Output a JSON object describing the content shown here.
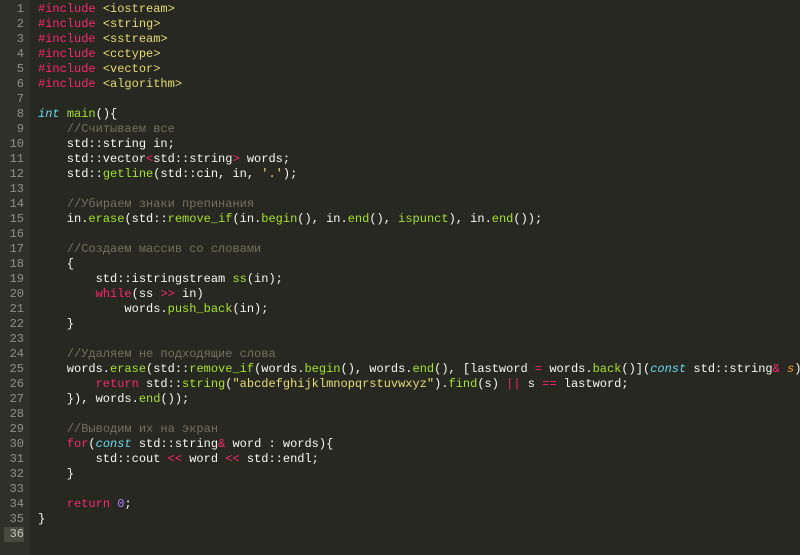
{
  "file_language": "cpp",
  "lines": [
    [
      {
        "t": "#include",
        "c": "include"
      },
      {
        "t": " ",
        "c": "punc"
      },
      {
        "t": "<iostream>",
        "c": "header"
      }
    ],
    [
      {
        "t": "#include",
        "c": "include"
      },
      {
        "t": " ",
        "c": "punc"
      },
      {
        "t": "<string>",
        "c": "header"
      }
    ],
    [
      {
        "t": "#include",
        "c": "include"
      },
      {
        "t": " ",
        "c": "punc"
      },
      {
        "t": "<sstream>",
        "c": "header"
      }
    ],
    [
      {
        "t": "#include",
        "c": "include"
      },
      {
        "t": " ",
        "c": "punc"
      },
      {
        "t": "<cctype>",
        "c": "header"
      }
    ],
    [
      {
        "t": "#include",
        "c": "include"
      },
      {
        "t": " ",
        "c": "punc"
      },
      {
        "t": "<vector>",
        "c": "header"
      }
    ],
    [
      {
        "t": "#include",
        "c": "include"
      },
      {
        "t": " ",
        "c": "punc"
      },
      {
        "t": "<algorithm>",
        "c": "header"
      }
    ],
    [],
    [
      {
        "t": "int",
        "c": "keyword"
      },
      {
        "t": " ",
        "c": "punc"
      },
      {
        "t": "main",
        "c": "func"
      },
      {
        "t": "(){",
        "c": "punc"
      }
    ],
    [
      {
        "t": "    ",
        "c": "punc"
      },
      {
        "t": "//Считываем все",
        "c": "comment"
      }
    ],
    [
      {
        "t": "    std::string in;",
        "c": "ident"
      }
    ],
    [
      {
        "t": "    std::vector",
        "c": "ident"
      },
      {
        "t": "<",
        "c": "op"
      },
      {
        "t": "std::string",
        "c": "ident"
      },
      {
        "t": ">",
        "c": "op"
      },
      {
        "t": " words;",
        "c": "ident"
      }
    ],
    [
      {
        "t": "    std::",
        "c": "ident"
      },
      {
        "t": "getline",
        "c": "func"
      },
      {
        "t": "(std::cin, in, ",
        "c": "ident"
      },
      {
        "t": "'.'",
        "c": "string"
      },
      {
        "t": ");",
        "c": "ident"
      }
    ],
    [],
    [
      {
        "t": "    ",
        "c": "punc"
      },
      {
        "t": "//Убираем знаки препинания",
        "c": "comment"
      }
    ],
    [
      {
        "t": "    in.",
        "c": "ident"
      },
      {
        "t": "erase",
        "c": "func"
      },
      {
        "t": "(std::",
        "c": "ident"
      },
      {
        "t": "remove_if",
        "c": "func"
      },
      {
        "t": "(in.",
        "c": "ident"
      },
      {
        "t": "begin",
        "c": "func"
      },
      {
        "t": "(), in.",
        "c": "ident"
      },
      {
        "t": "end",
        "c": "func"
      },
      {
        "t": "(), ",
        "c": "ident"
      },
      {
        "t": "ispunct",
        "c": "func"
      },
      {
        "t": "), in.",
        "c": "ident"
      },
      {
        "t": "end",
        "c": "func"
      },
      {
        "t": "());",
        "c": "ident"
      }
    ],
    [],
    [
      {
        "t": "    ",
        "c": "punc"
      },
      {
        "t": "//Создаем массив со словами",
        "c": "comment"
      }
    ],
    [
      {
        "t": "    {",
        "c": "ident"
      }
    ],
    [
      {
        "t": "        std::istringstream ",
        "c": "ident"
      },
      {
        "t": "ss",
        "c": "func"
      },
      {
        "t": "(in);",
        "c": "ident"
      }
    ],
    [
      {
        "t": "        ",
        "c": "punc"
      },
      {
        "t": "while",
        "c": "keyword2"
      },
      {
        "t": "(ss ",
        "c": "ident"
      },
      {
        "t": ">>",
        "c": "op"
      },
      {
        "t": " in)",
        "c": "ident"
      }
    ],
    [
      {
        "t": "            words.",
        "c": "ident"
      },
      {
        "t": "push_back",
        "c": "func"
      },
      {
        "t": "(in);",
        "c": "ident"
      }
    ],
    [
      {
        "t": "    }",
        "c": "ident"
      }
    ],
    [],
    [
      {
        "t": "    ",
        "c": "punc"
      },
      {
        "t": "//Удаляем не подходящие слова",
        "c": "comment"
      }
    ],
    [
      {
        "t": "    words.",
        "c": "ident"
      },
      {
        "t": "erase",
        "c": "func"
      },
      {
        "t": "(std::",
        "c": "ident"
      },
      {
        "t": "remove_if",
        "c": "func"
      },
      {
        "t": "(words.",
        "c": "ident"
      },
      {
        "t": "begin",
        "c": "func"
      },
      {
        "t": "(), words.",
        "c": "ident"
      },
      {
        "t": "end",
        "c": "func"
      },
      {
        "t": "(), [lastword ",
        "c": "ident"
      },
      {
        "t": "=",
        "c": "op"
      },
      {
        "t": " words.",
        "c": "ident"
      },
      {
        "t": "back",
        "c": "func"
      },
      {
        "t": "()](",
        "c": "ident"
      },
      {
        "t": "const",
        "c": "keyword"
      },
      {
        "t": " std::string",
        "c": "ident"
      },
      {
        "t": "&",
        "c": "op"
      },
      {
        "t": " ",
        "c": "ident"
      },
      {
        "t": "s",
        "c": "param"
      },
      {
        "t": "){",
        "c": "ident"
      }
    ],
    [
      {
        "t": "        ",
        "c": "punc"
      },
      {
        "t": "return",
        "c": "keyword2"
      },
      {
        "t": " std::",
        "c": "ident"
      },
      {
        "t": "string",
        "c": "func"
      },
      {
        "t": "(",
        "c": "ident"
      },
      {
        "t": "\"abcdefghijklmnopqrstuvwxyz\"",
        "c": "string"
      },
      {
        "t": ").",
        "c": "ident"
      },
      {
        "t": "find",
        "c": "func"
      },
      {
        "t": "(s) ",
        "c": "ident"
      },
      {
        "t": "||",
        "c": "op"
      },
      {
        "t": " s ",
        "c": "ident"
      },
      {
        "t": "==",
        "c": "op"
      },
      {
        "t": " lastword;",
        "c": "ident"
      }
    ],
    [
      {
        "t": "    }), words.",
        "c": "ident"
      },
      {
        "t": "end",
        "c": "func"
      },
      {
        "t": "());",
        "c": "ident"
      }
    ],
    [],
    [
      {
        "t": "    ",
        "c": "punc"
      },
      {
        "t": "//Выводим их на экран",
        "c": "comment"
      }
    ],
    [
      {
        "t": "    ",
        "c": "punc"
      },
      {
        "t": "for",
        "c": "keyword2"
      },
      {
        "t": "(",
        "c": "ident"
      },
      {
        "t": "const",
        "c": "keyword"
      },
      {
        "t": " std::string",
        "c": "ident"
      },
      {
        "t": "&",
        "c": "op"
      },
      {
        "t": " word : words){",
        "c": "ident"
      }
    ],
    [
      {
        "t": "        std::cout ",
        "c": "ident"
      },
      {
        "t": "<<",
        "c": "op"
      },
      {
        "t": " word ",
        "c": "ident"
      },
      {
        "t": "<<",
        "c": "op"
      },
      {
        "t": " std::endl;",
        "c": "ident"
      }
    ],
    [
      {
        "t": "    }",
        "c": "ident"
      }
    ],
    [],
    [
      {
        "t": "    ",
        "c": "punc"
      },
      {
        "t": "return",
        "c": "keyword2"
      },
      {
        "t": " ",
        "c": "ident"
      },
      {
        "t": "0",
        "c": "number"
      },
      {
        "t": ";",
        "c": "ident"
      }
    ],
    [
      {
        "t": "}",
        "c": "ident"
      }
    ],
    []
  ],
  "active_line": 36
}
